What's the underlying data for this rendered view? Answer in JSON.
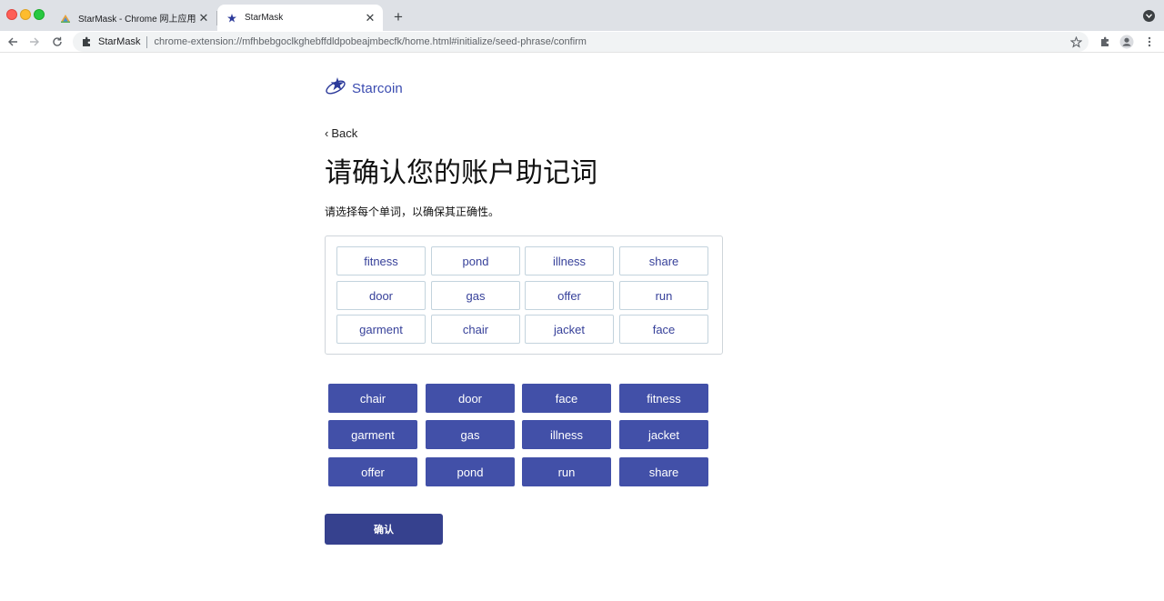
{
  "browser": {
    "tabs": [
      {
        "title": "StarMask - Chrome 网上应用店",
        "close_glyph": "✕"
      },
      {
        "title": "StarMask",
        "close_glyph": "✕"
      }
    ],
    "new_tab_glyph": "+",
    "site_name": "StarMask",
    "url": "chrome-extension://mfhbebgoclkghebffdldpobeajmbecfk/home.html#initialize/seed-phrase/confirm",
    "icons": [
      "back-icon",
      "forward-icon",
      "reload-icon",
      "puzzle-icon",
      "star-icon",
      "profile-icon",
      "menu-icon"
    ]
  },
  "header": {
    "logo_text": "Starcoin",
    "back_label": "Back",
    "back_glyph": "‹"
  },
  "main": {
    "title": "请确认您的账户助记词",
    "instruction": "请选择每个单词，以确保其正确性。",
    "selected_words": [
      "fitness",
      "pond",
      "illness",
      "share",
      "door",
      "gas",
      "offer",
      "run",
      "garment",
      "chair",
      "jacket",
      "face"
    ],
    "word_options": [
      "chair",
      "door",
      "face",
      "fitness",
      "garment",
      "gas",
      "illness",
      "jacket",
      "offer",
      "pond",
      "run",
      "share"
    ],
    "confirm_label": "确认"
  },
  "colors": {
    "accent": "#4250a8",
    "confirm": "#36418e",
    "slot_text": "#37419a",
    "logo": "#3a4bb0"
  }
}
